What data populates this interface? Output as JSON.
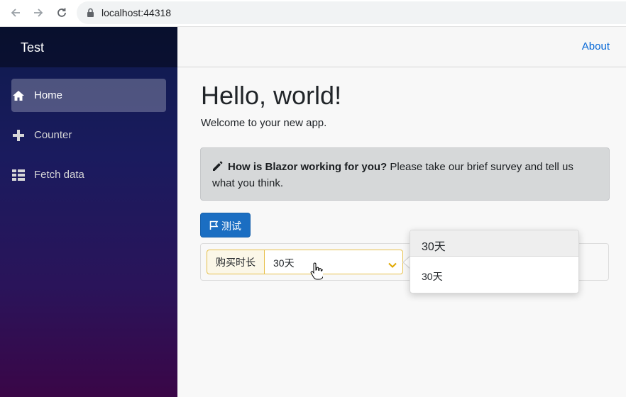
{
  "browser": {
    "url": "localhost:44318",
    "icons": [
      "back-arrow-icon",
      "forward-arrow-icon",
      "reload-icon",
      "lock-icon"
    ]
  },
  "sidebar": {
    "brand": "Test",
    "items": [
      {
        "label": "Home",
        "icon": "home-icon",
        "active": true
      },
      {
        "label": "Counter",
        "icon": "plus-icon",
        "active": false
      },
      {
        "label": "Fetch data",
        "icon": "list-icon",
        "active": false
      }
    ]
  },
  "topbar": {
    "about": "About"
  },
  "main": {
    "heading": "Hello, world!",
    "welcome": "Welcome to your new app.",
    "survey": {
      "prompt": "How is Blazor working for you?",
      "text": " Please take our brief survey and tell us what you think."
    },
    "test_button": "测试",
    "purchase": {
      "label": "购买时长",
      "selected": "30天",
      "dropdown_header": "30天",
      "options": [
        "30天"
      ]
    }
  },
  "colors": {
    "primary": "#1b6ec2",
    "link": "#0366d6",
    "select_border": "#e7c04a"
  }
}
